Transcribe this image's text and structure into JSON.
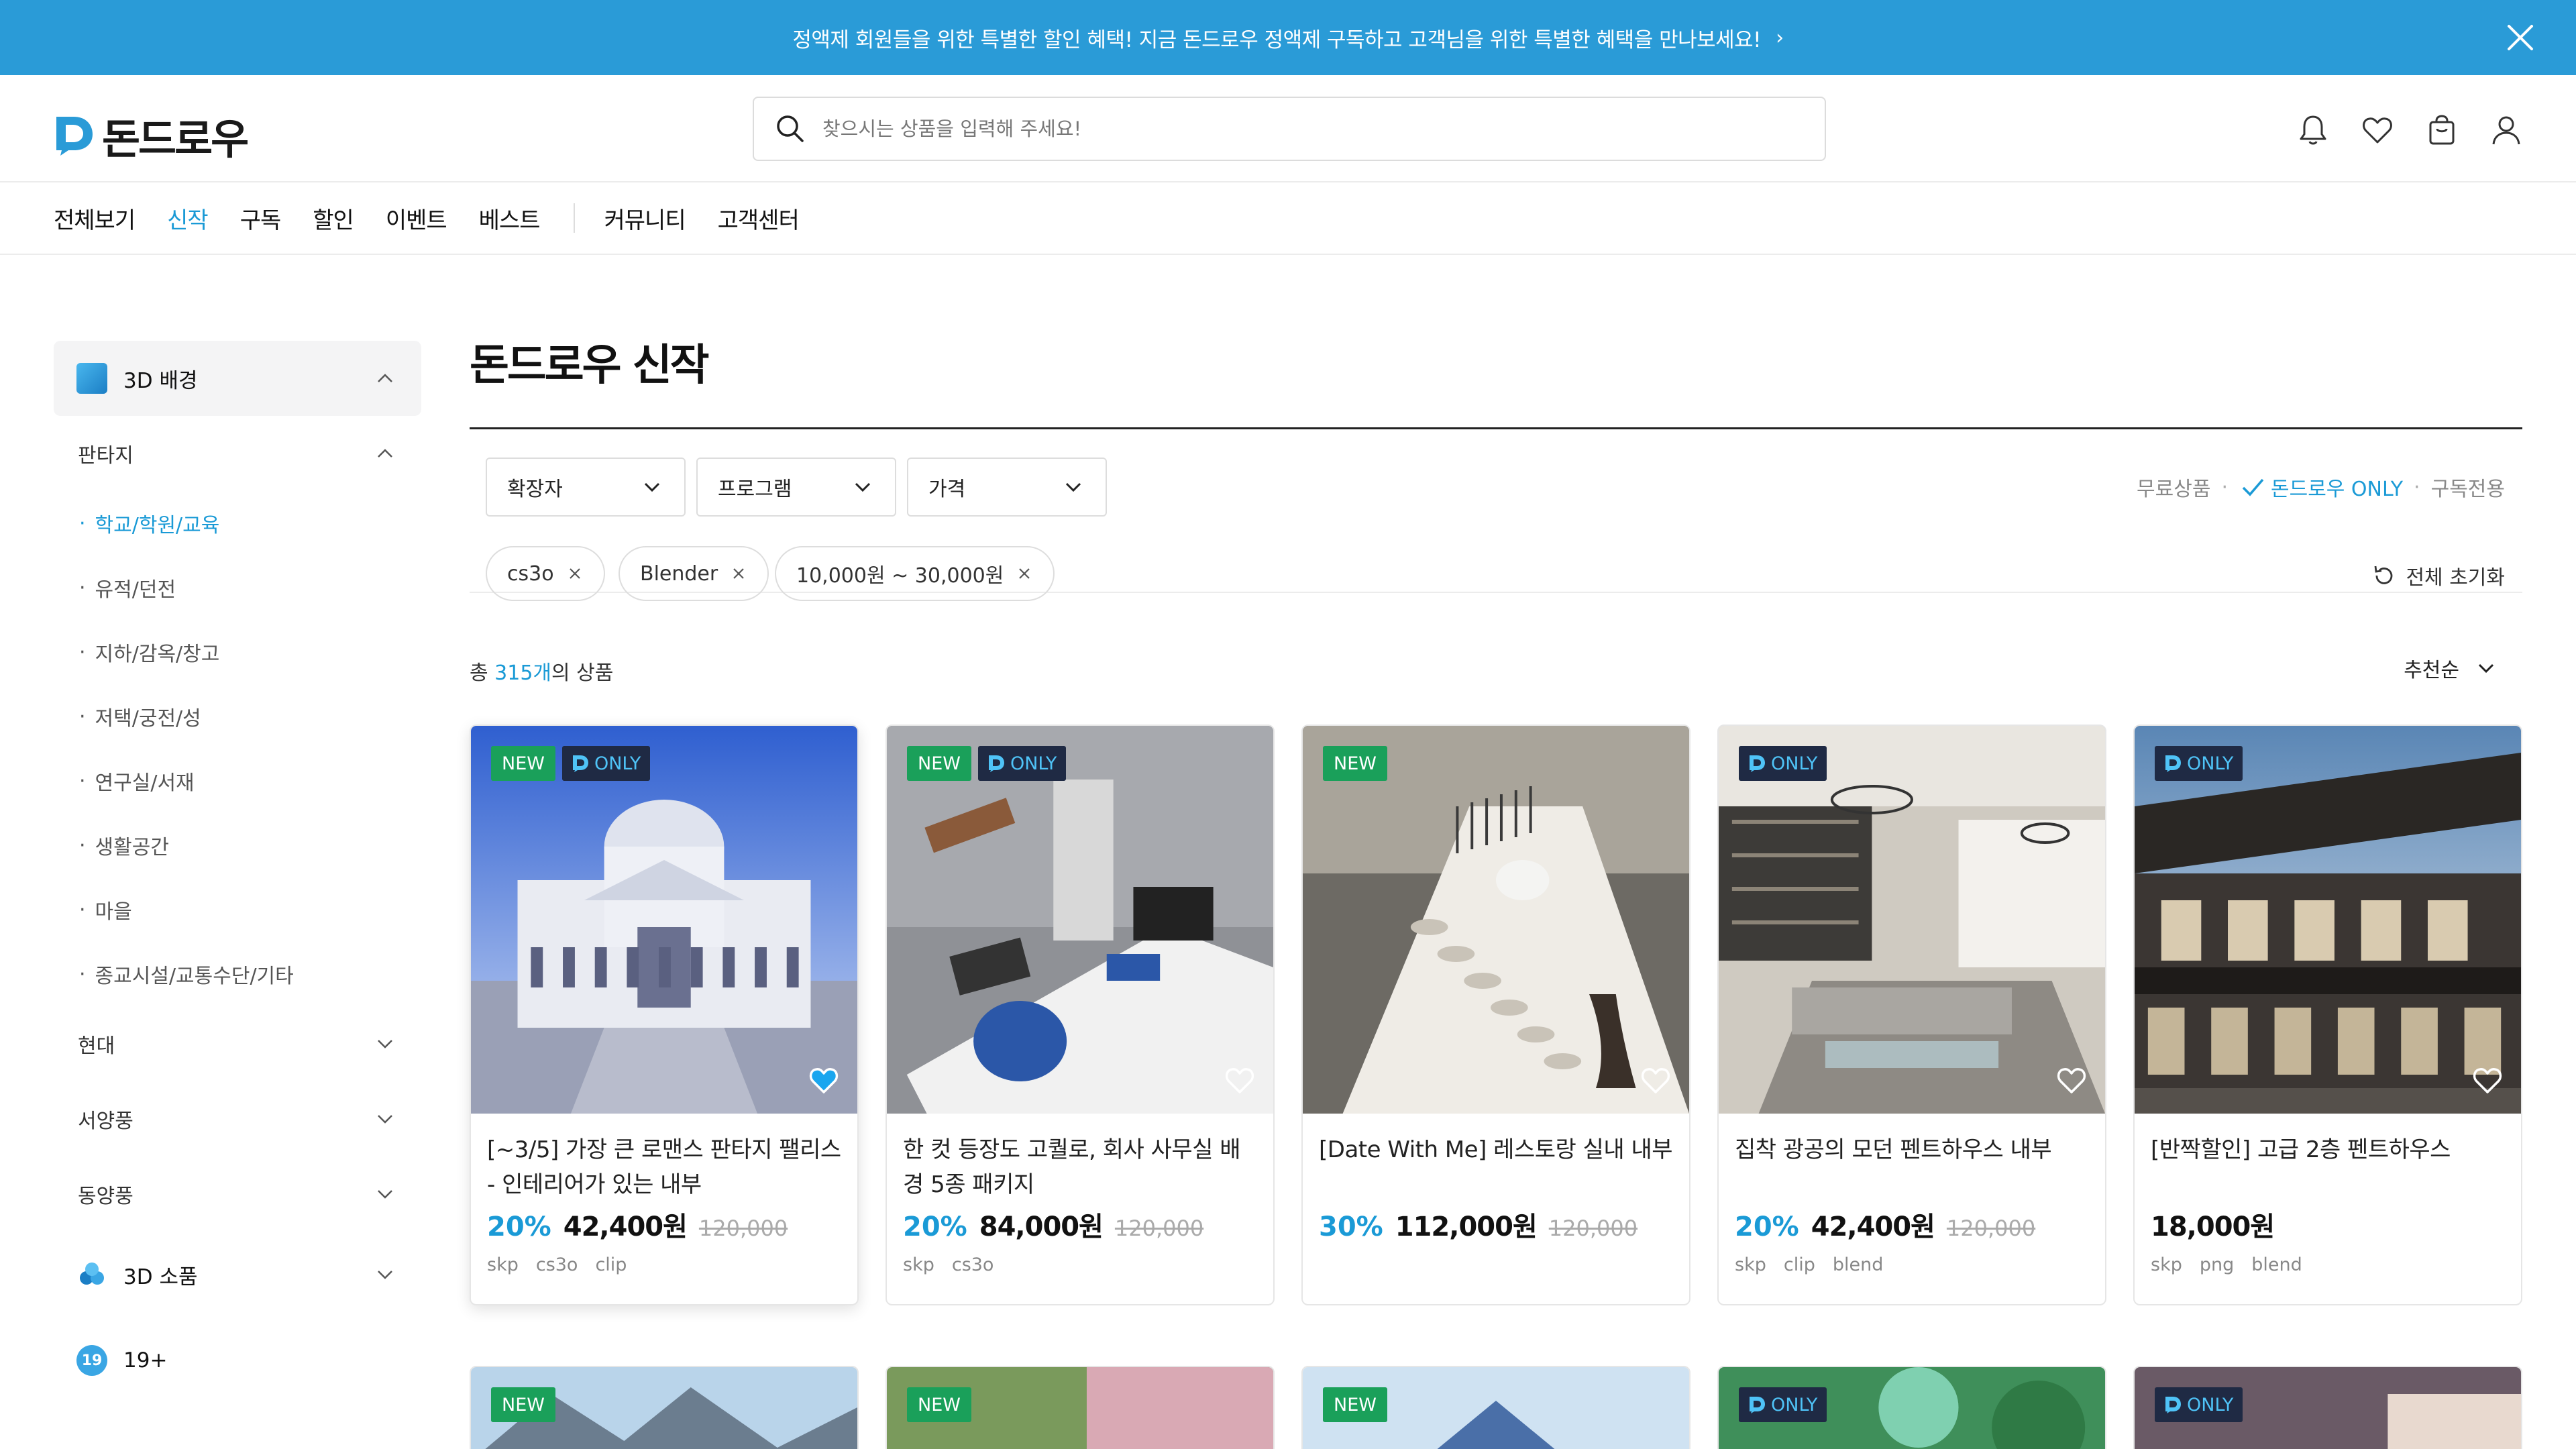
{
  "banner": {
    "text": "정액제 회원들을 위한 특별한 할인 혜택!  지금 돈드로우 정액제 구독하고 고객님을 위한 특별한 혜택을 만나보세요!",
    "chevron": "›",
    "close_icon": "close-icon"
  },
  "header": {
    "logo_text": "돈드로우",
    "search_placeholder": "찾으시는 상품을 입력해 주세요!",
    "icons": [
      "bell-icon",
      "heart-icon",
      "bag-icon",
      "user-icon"
    ]
  },
  "nav": {
    "items": [
      "전체보기",
      "신작",
      "구독",
      "할인",
      "이벤트",
      "베스트"
    ],
    "items2": [
      "커뮤니티",
      "고객센터"
    ],
    "active": "신작"
  },
  "sidebar": {
    "category": "3D 배경",
    "sub_open": "판타지",
    "sub_items": [
      "학교/학원/교육",
      "유적/던전",
      "지하/감옥/창고",
      "저택/궁전/성",
      "연구실/서재",
      "생활공간",
      "마을",
      "종교시설/교통수단/기타"
    ],
    "sub_active": "학교/학원/교육",
    "sub_closed": [
      "현대",
      "서양풍",
      "동양풍"
    ],
    "cat2": "3D 소품",
    "cat3_badge": "19",
    "cat3": "19+"
  },
  "main": {
    "title": "돈드로우 신작",
    "filters": [
      "확장자",
      "프로그램",
      "가격"
    ],
    "modes": [
      "무료상품",
      "돈드로우 ONLY",
      "구독전용"
    ],
    "mode_active": "돈드로우 ONLY",
    "chips": [
      "cs3o",
      "Blender",
      "10,000원 ~ 30,000원"
    ],
    "reset": "전체 초기화",
    "count_prefix": "총 ",
    "count": "315개",
    "count_suffix": "의 상품",
    "sort": "추천순"
  },
  "badges": {
    "new": "NEW",
    "only": "ONLY"
  },
  "products": [
    {
      "title": "[~3/5] 가장 큰 로맨스 판타지 팰리스 - 인테리어가 있는 내부",
      "discount": "20%",
      "price": "42,400원",
      "original": "120,000",
      "tags": [
        "skp",
        "cs3o",
        "clip"
      ],
      "new": true,
      "only": true,
      "liked": true
    },
    {
      "title": "한 컷 등장도 고퀄로, 회사 사무실 배경 5종 패키지",
      "discount": "20%",
      "price": "84,000원",
      "original": "120,000",
      "tags": [
        "skp",
        "cs3o"
      ],
      "new": true,
      "only": true,
      "liked": false
    },
    {
      "title": "[Date With Me] 레스토랑 실내 내부",
      "discount": "30%",
      "price": "112,000원",
      "original": "120,000",
      "tags": [],
      "new": true,
      "only": false,
      "liked": false
    },
    {
      "title": "집착 광공의 모던 펜트하우스 내부",
      "discount": "20%",
      "price": "42,400원",
      "original": "120,000",
      "tags": [
        "skp",
        "clip",
        "blend"
      ],
      "new": false,
      "only": true,
      "liked": false
    },
    {
      "title": "[반짝할인] 고급 2층 펜트하우스",
      "discount": "",
      "price": "18,000원",
      "original": "",
      "tags": [
        "skp",
        "png",
        "blend"
      ],
      "new": false,
      "only": true,
      "liked": false
    }
  ],
  "products_row2": [
    {
      "new": true,
      "only": false
    },
    {
      "new": true,
      "only": false
    },
    {
      "new": true,
      "only": false
    },
    {
      "new": false,
      "only": true
    },
    {
      "new": false,
      "only": true
    }
  ],
  "colors": {
    "accent": "#1a9ad6",
    "banner": "#2a9bd7",
    "new_badge": "#1aa05a",
    "only_badge": "#1f2a44"
  }
}
